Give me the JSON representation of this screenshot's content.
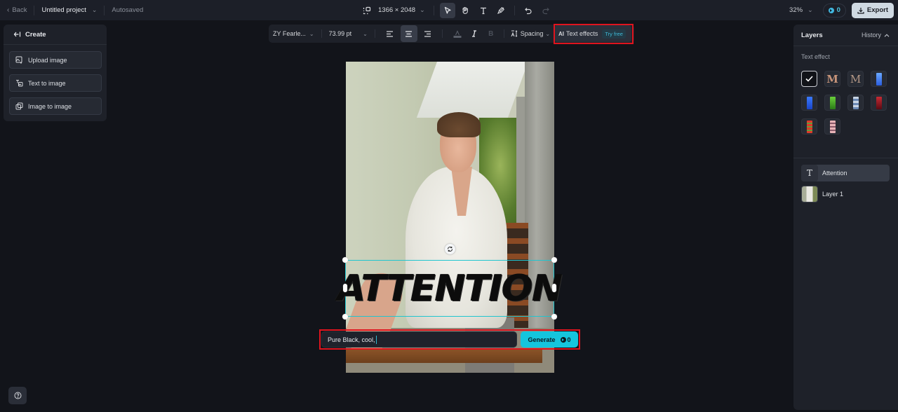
{
  "topbar": {
    "back_label": "Back",
    "project_title": "Untitled project",
    "save_status": "Autosaved",
    "canvas_size": "1366 × 2048",
    "zoom_level": "32%",
    "credits": "0",
    "export_label": "Export",
    "tools": [
      "resize",
      "select",
      "hand",
      "text",
      "brush",
      "undo",
      "redo"
    ],
    "active_tool": "select"
  },
  "left_panel": {
    "header": "Create",
    "items": [
      {
        "label": "Upload image",
        "icon": "upload-image-icon"
      },
      {
        "label": "Text to image",
        "icon": "text-to-image-icon"
      },
      {
        "label": "Image to image",
        "icon": "image-to-image-icon"
      }
    ]
  },
  "format_toolbar": {
    "font_family": "ZY Fearle...",
    "font_size": "73.99 pt",
    "alignment": [
      "left",
      "center",
      "right"
    ],
    "active_alignment": "center",
    "spacing_label": "Spacing",
    "text_effects_label": "Text effects",
    "text_effects_badge": "Try free"
  },
  "canvas": {
    "text_layer": "ATTENTION",
    "prompt_value": "Pure Black, cool,",
    "generate_label": "Generate",
    "generate_cost": "0"
  },
  "right_panel": {
    "title": "Layers",
    "history_label": "History",
    "section_label": "Text effect",
    "effects": [
      {
        "name": "pure-black",
        "selected": true,
        "color": "#111111"
      },
      {
        "name": "wood-letter",
        "selected": false,
        "color": "#c8957a"
      },
      {
        "name": "brown-sketch",
        "selected": false,
        "color": "#9a7a6a"
      },
      {
        "name": "blue-crystal",
        "selected": false,
        "color": "#3a7ae0"
      },
      {
        "name": "blue-neon",
        "selected": false,
        "color": "#2a5ee8"
      },
      {
        "name": "green-moss",
        "selected": false,
        "color": "#3fa82a"
      },
      {
        "name": "floral-blue",
        "selected": false,
        "color": "#8aa4c8"
      },
      {
        "name": "red-dark",
        "selected": false,
        "color": "#9a1a24"
      },
      {
        "name": "red-flowers",
        "selected": false,
        "color": "#c8302a"
      },
      {
        "name": "pink-floral",
        "selected": false,
        "color": "#c8909a"
      }
    ],
    "layers": [
      {
        "label": "Attention",
        "type": "text",
        "active": true
      },
      {
        "label": "Layer 1",
        "type": "image",
        "active": false
      }
    ]
  },
  "colors": {
    "accent": "#15c5dd",
    "selection": "#20c5cf",
    "highlight": "#e0141e"
  }
}
